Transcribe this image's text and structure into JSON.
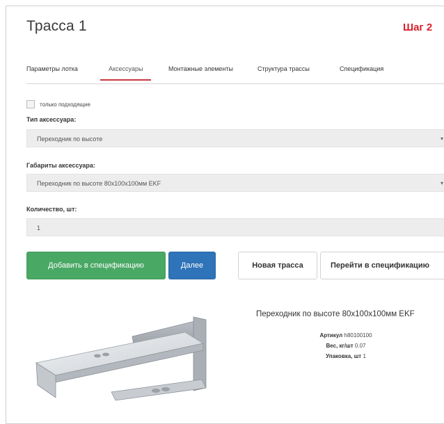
{
  "page": {
    "title": "Трасса 1",
    "step": "Шаг 2"
  },
  "tabs": [
    {
      "label": "Параметры лотка",
      "active": false
    },
    {
      "label": "Аксессуары",
      "active": true
    },
    {
      "label": "Монтажные элементы",
      "active": false
    },
    {
      "label": "Структура трассы",
      "active": false
    },
    {
      "label": "Спецификация",
      "active": false
    }
  ],
  "filter": {
    "only_matching_label": "только подходящие",
    "checked": false
  },
  "form": {
    "accessory_type_label": "Тип аксессуара:",
    "accessory_type_value": "Переходник по высоте",
    "accessory_size_label": "Габариты аксессуара:",
    "accessory_size_value": "Переходник по высоте 80х100х100мм EKF",
    "quantity_label": "Количество, шт:",
    "quantity_value": "1"
  },
  "buttons": {
    "add_to_spec": "Добавить в спецификацию",
    "next": "Далее",
    "new_route": "Новая трасса",
    "go_to_spec": "Перейти в спецификацию"
  },
  "product": {
    "name": "Переходник по высоте 80х100х100мм EKF",
    "article_label": "Артикул",
    "article_value": "h80100100",
    "weight_label": "Вес, кг/шт",
    "weight_value": "0.07",
    "pack_label": "Упаковка, шт",
    "pack_value": "1"
  },
  "colors": {
    "accent_red": "#d8202a",
    "green_button": "#4aa865",
    "blue_button": "#2f73b8"
  }
}
